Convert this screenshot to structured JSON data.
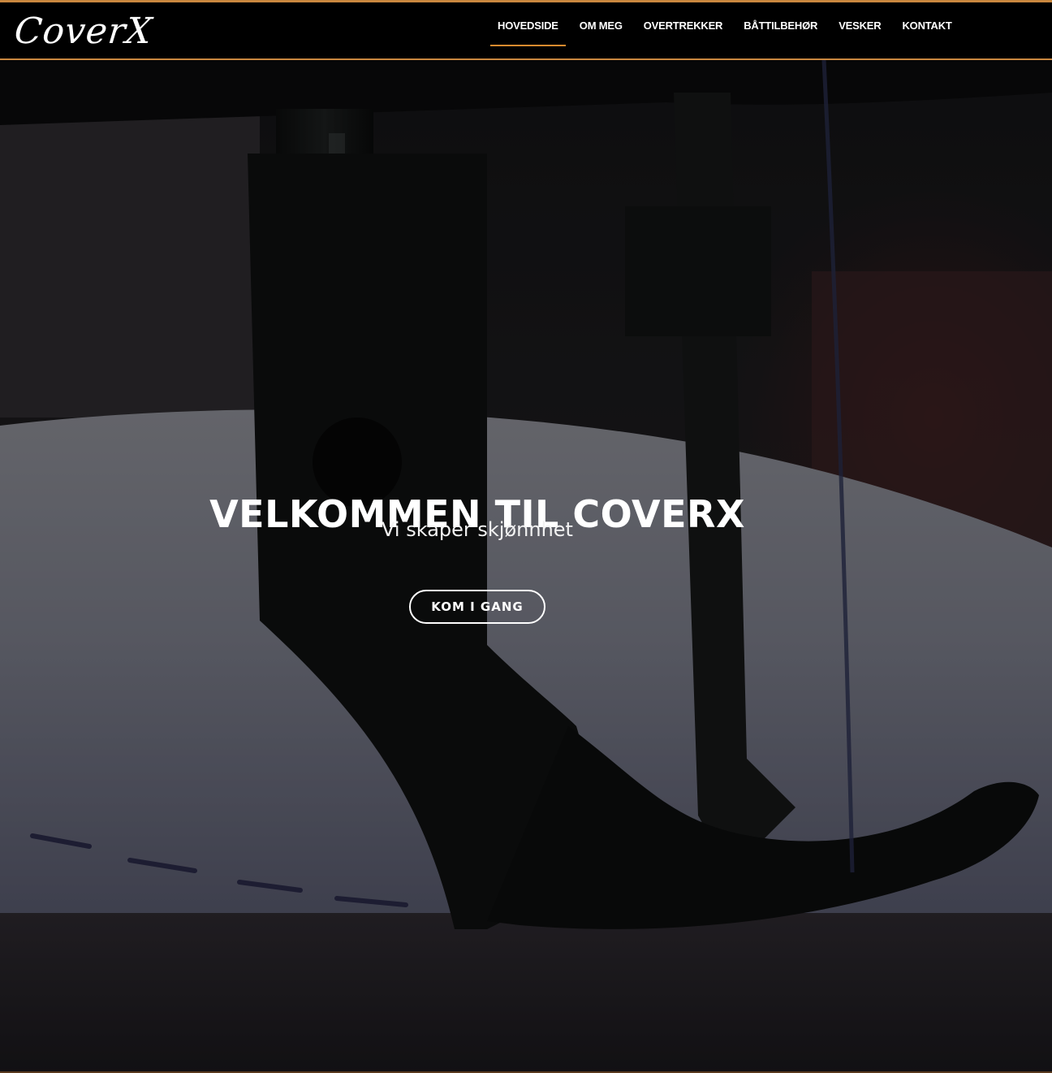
{
  "brand": {
    "logo_text": "CoverX",
    "accent_color": "#e08a2e"
  },
  "nav": {
    "items": [
      {
        "label": "HOVEDSIDE",
        "active": true
      },
      {
        "label": "OM MEG",
        "active": false
      },
      {
        "label": "OVERTREKKER",
        "active": false
      },
      {
        "label": "BÅTTILBEHØR",
        "active": false
      },
      {
        "label": "VESKER",
        "active": false
      },
      {
        "label": "KONTAKT",
        "active": false
      }
    ]
  },
  "hero": {
    "title": "VELKOMMEN TIL COVERX",
    "subtitle": "Vi skaper skjønnhet",
    "cta_label": "KOM I GANG",
    "background": "sewing-machine-presser-foot-photo"
  }
}
